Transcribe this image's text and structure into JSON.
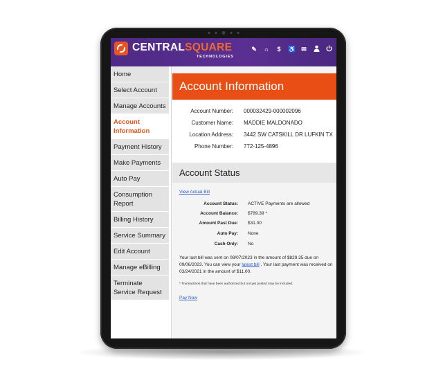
{
  "brand": {
    "name_part1": "CENTRAL",
    "name_part2": "SQUARE",
    "subtitle": "TECHNOLOGIES"
  },
  "header_icons": [
    {
      "name": "pencil-icon",
      "glyph": "✎"
    },
    {
      "name": "home-icon",
      "glyph": "⌂"
    },
    {
      "name": "dollar-icon",
      "glyph": "$"
    },
    {
      "name": "accessibility-icon",
      "glyph": "♿"
    },
    {
      "name": "mail-icon",
      "glyph": "✉"
    },
    {
      "name": "user-icon",
      "glyph": "👤"
    },
    {
      "name": "logout-icon",
      "glyph": "⏻"
    }
  ],
  "sidebar": {
    "items": [
      {
        "label": "Home"
      },
      {
        "label": "Select Account"
      },
      {
        "label": "Manage Accounts"
      },
      {
        "label": "Account Information",
        "active": true
      },
      {
        "label": "Payment History"
      },
      {
        "label": "Make Payments"
      },
      {
        "label": "Auto Pay"
      },
      {
        "label": "Consumption Report"
      },
      {
        "label": "Billing History"
      },
      {
        "label": "Service Summary"
      },
      {
        "label": "Edit Account"
      },
      {
        "label": "Manage eBilling"
      },
      {
        "label": "Terminate Service Request"
      }
    ]
  },
  "account_info": {
    "title": "Account Information",
    "fields": [
      {
        "label": "Account Number:",
        "value": "000032429-000002096"
      },
      {
        "label": "Customer Name:",
        "value": "MADDIE MALDONADO"
      },
      {
        "label": "Location Address:",
        "value": "3442 SW CATSKILL DR LUFKIN TX"
      },
      {
        "label": "Phone Number:",
        "value": "772-125-4896"
      }
    ]
  },
  "account_status": {
    "title": "Account Status",
    "view_bill_link": "View Actual Bill",
    "fields": [
      {
        "label": "Account Status:",
        "value": "ACTIVE Payments are allowed"
      },
      {
        "label": "Account Balance:",
        "value": "$789.39 *"
      },
      {
        "label": "Amount Past Due:",
        "value": "$31.00"
      },
      {
        "label": "Auto Pay:",
        "value": "None"
      },
      {
        "label": "Cash Only:",
        "value": "No"
      }
    ],
    "paragraph_part1": "Your last bill was sent on 08/07/2023 in the amount of $829.35 due on 09/06/2023. You can view your ",
    "latest_bill_link": "latest bill",
    "paragraph_part2": " . Your last payment was received on 03/24/2021 in the amount of $11.00.",
    "footnote": "* Transactions that have been authorized but not yet posted may be included.",
    "pay_now_link": "Pay Now"
  }
}
